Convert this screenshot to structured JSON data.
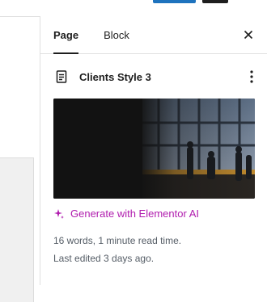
{
  "sidebar": {
    "tabs": [
      {
        "label": "Page"
      },
      {
        "label": "Block"
      }
    ]
  },
  "document": {
    "title": "Clients Style 3"
  },
  "generate_ai": {
    "label": "Generate with Elementor AI"
  },
  "meta": {
    "word_info": "16 words, 1 minute read time.",
    "last_edited": "Last edited 3 days ago."
  },
  "colors": {
    "primary_button": "#1e73be",
    "ai_accent": "#b01cae"
  }
}
